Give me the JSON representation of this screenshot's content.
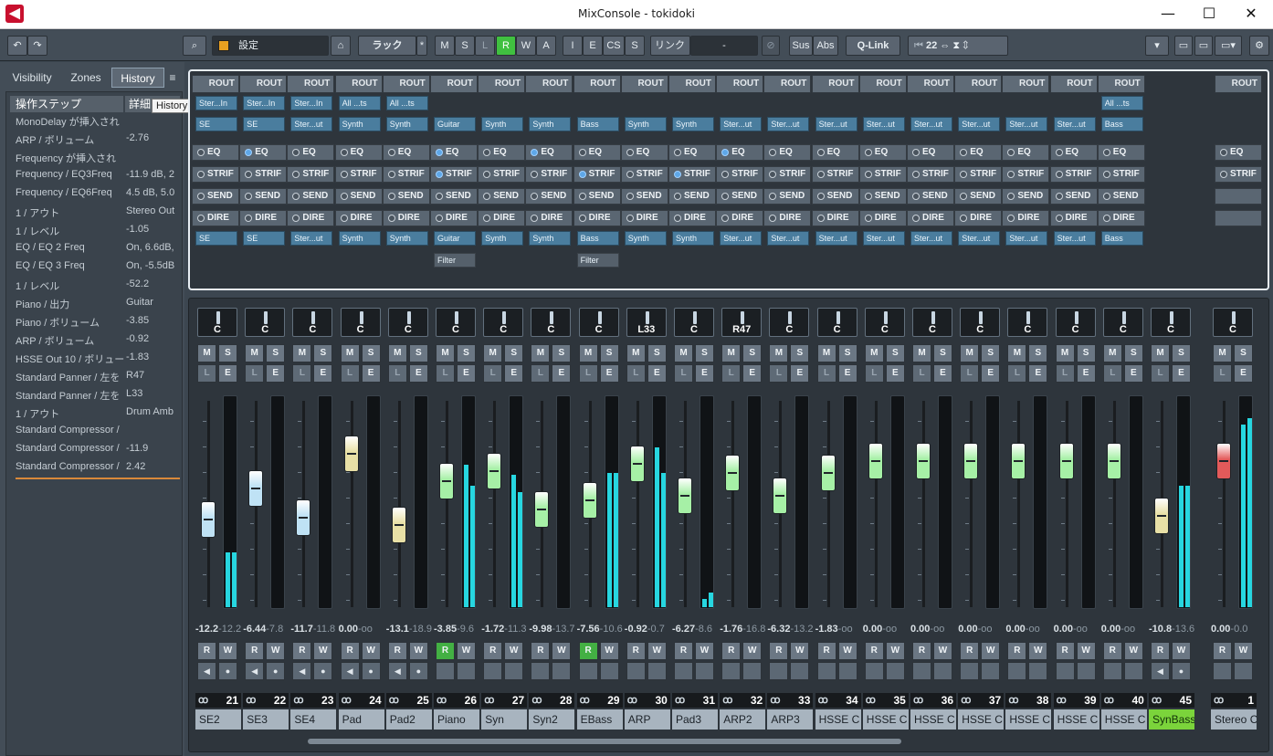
{
  "window": {
    "title": "MixConsole - tokidoki",
    "min": "—",
    "max": "☐",
    "close": "✕",
    "logo": "◀"
  },
  "toolbar": {
    "undo": "↶",
    "redo": "↷",
    "search": "⌕",
    "preset": "設定",
    "rack": "ラック",
    "rack_star": "*",
    "m": "M",
    "s": "S",
    "l": "L",
    "r": "R",
    "w": "W",
    "a": "A",
    "i": "I",
    "e": "E",
    "cs": "CS",
    "s2": "S",
    "link": "リンク",
    "link_value": "-",
    "sus": "Sus",
    "abs": "Abs",
    "qlink": "Q-Link",
    "count": "22",
    "menu_arrow": "▾",
    "gear": "⚙"
  },
  "left": {
    "tabs": [
      {
        "label": "Visibility"
      },
      {
        "label": "Zones"
      },
      {
        "label": "History"
      }
    ],
    "tooltip": "History",
    "headers": {
      "step": "操作ステップ",
      "detail": "詳細"
    },
    "rows": [
      {
        "a": "MonoDelay が挿入され",
        "b": ""
      },
      {
        "a": "ARP / ボリューム",
        "b": "-2.76"
      },
      {
        "a": "Frequency が挿入され",
        "b": ""
      },
      {
        "a": "Frequency / EQ3Freq",
        "b": "-11.9 dB, 2"
      },
      {
        "a": "Frequency / EQ6Freq",
        "b": "4.5 dB, 5.0"
      },
      {
        "a": "1 / アウト",
        "b": "Stereo Out"
      },
      {
        "a": "1 / レベル",
        "b": "-1.05"
      },
      {
        "a": "EQ / EQ 2 Freq",
        "b": "On, 6.6dB,"
      },
      {
        "a": "EQ / EQ 3 Freq",
        "b": "On, -5.5dB"
      },
      {
        "a": "1 / レベル",
        "b": "-52.2"
      },
      {
        "a": "Piano / 出力",
        "b": "Guitar"
      },
      {
        "a": "Piano / ボリューム",
        "b": "-3.85"
      },
      {
        "a": "ARP / ボリューム",
        "b": "-0.92"
      },
      {
        "a": "HSSE Out 10 / ボリュー",
        "b": "-1.83"
      },
      {
        "a": "Standard Panner / 左を",
        "b": "R47"
      },
      {
        "a": "Standard Panner / 左を",
        "b": "L33"
      },
      {
        "a": "1 / アウト",
        "b": "Drum Amb"
      },
      {
        "a": "Standard Compressor /",
        "b": ""
      },
      {
        "a": "Standard Compressor /",
        "b": "-11.9"
      },
      {
        "a": "Standard Compressor /",
        "b": "2.42"
      }
    ]
  },
  "routing": {
    "rout": "ROUT",
    "eq": "EQ",
    "strip": "STRIF",
    "send": "SEND",
    "direct": "DIRE",
    "inputs": [
      "Ster...In",
      "Ster...In",
      "Ster...In",
      "All ...ts",
      "All ...ts",
      "",
      "",
      "",
      "",
      "",
      "",
      "",
      "",
      "",
      "",
      "",
      "",
      "",
      "",
      "All ...ts",
      ""
    ],
    "outputs": [
      "SE",
      "SE",
      "Ster...ut",
      "Synth",
      "Synth",
      "Guitar",
      "Synth",
      "Synth",
      "Bass",
      "Synth",
      "Synth",
      "Ster...ut",
      "Ster...ut",
      "Ster...ut",
      "Ster...ut",
      "Ster...ut",
      "Ster...ut",
      "Ster...ut",
      "Ster...ut",
      "Bass",
      ""
    ],
    "filters": [
      "",
      "",
      "",
      "",
      "",
      "Filter",
      "",
      "",
      "Filter",
      "",
      "",
      "",
      "",
      "",
      "",
      "",
      "",
      "",
      "",
      "",
      ""
    ]
  },
  "channels": [
    {
      "name": "SE2",
      "num": "21",
      "pan": "C",
      "vol": "-12.2",
      "peak": "-12.2",
      "fader": 0.42,
      "color": "#bfe2f5",
      "meter": [
        0.26,
        0.26
      ],
      "rw": "rw",
      "bottom": "mono"
    },
    {
      "name": "SE3",
      "num": "22",
      "pan": "C",
      "vol": "-6.44",
      "peak": "-7.8",
      "fader": 0.6,
      "color": "#bfe2f5",
      "meter": [
        0,
        0
      ],
      "rw": "rw",
      "bottom": "mono"
    },
    {
      "name": "SE4",
      "num": "23",
      "pan": "C",
      "vol": "-11.7",
      "peak": "-11.8",
      "fader": 0.43,
      "color": "#bfe2f5",
      "meter": [
        0,
        0
      ],
      "rw": "rw",
      "bottom": "mono"
    },
    {
      "name": "Pad",
      "num": "24",
      "pan": "C",
      "vol": "0.00",
      "peak": "-oo",
      "fader": 0.8,
      "color": "#e8e0a6",
      "meter": [
        0,
        0
      ],
      "rw": "rw",
      "bottom": "mono"
    },
    {
      "name": "Pad2",
      "num": "25",
      "pan": "C",
      "vol": "-13.1",
      "peak": "-18.9",
      "fader": 0.39,
      "color": "#e8e0a6",
      "meter": [
        0,
        0
      ],
      "rw": "rw",
      "bottom": "mono"
    },
    {
      "name": "Piano",
      "num": "26",
      "pan": "C",
      "vol": "-3.85",
      "peak": "-9.6",
      "fader": 0.64,
      "color": "#a6f0a6",
      "meter": [
        0.68,
        0.58
      ],
      "rw": "Rw",
      "bottom": "none"
    },
    {
      "name": "Syn",
      "num": "27",
      "pan": "C",
      "vol": "-1.72",
      "peak": "-11.3",
      "fader": 0.7,
      "color": "#a6f0a6",
      "meter": [
        0.63,
        0.55
      ],
      "rw": "rw",
      "bottom": "none"
    },
    {
      "name": "Syn2",
      "num": "28",
      "pan": "C",
      "vol": "-9.98",
      "peak": "-13.7",
      "fader": 0.48,
      "color": "#a6f0a6",
      "meter": [
        0,
        0
      ],
      "rw": "rw",
      "bottom": "none"
    },
    {
      "name": "EBass",
      "num": "29",
      "pan": "C",
      "vol": "-7.56",
      "peak": "-10.6",
      "fader": 0.53,
      "color": "#a6f0a6",
      "meter": [
        0.64,
        0.64
      ],
      "rw": "Rw",
      "bottom": "none"
    },
    {
      "name": "ARP",
      "num": "30",
      "pan": "L33",
      "vol": "-0.92",
      "peak": "-0.7",
      "fader": 0.74,
      "color": "#a6f0a6",
      "meter": [
        0.76,
        0.64
      ],
      "rw": "rw",
      "bottom": "none"
    },
    {
      "name": "Pad3",
      "num": "31",
      "pan": "C",
      "vol": "-6.27",
      "peak": "-8.6",
      "fader": 0.56,
      "color": "#a6f0a6",
      "meter": [
        0.04,
        0.07
      ],
      "rw": "rw",
      "bottom": "none"
    },
    {
      "name": "ARP2",
      "num": "32",
      "pan": "R47",
      "vol": "-1.76",
      "peak": "-16.8",
      "fader": 0.69,
      "color": "#a6f0a6",
      "meter": [
        0,
        0
      ],
      "rw": "rw",
      "bottom": "none"
    },
    {
      "name": "ARP3",
      "num": "33",
      "pan": "C",
      "vol": "-6.32",
      "peak": "-13.2",
      "fader": 0.56,
      "color": "#a6f0a6",
      "meter": [
        0,
        0
      ],
      "rw": "rw",
      "bottom": "none"
    },
    {
      "name": "HSSE C",
      "num": "34",
      "pan": "C",
      "vol": "-1.83",
      "peak": "-oo",
      "fader": 0.69,
      "color": "#a6f0a6",
      "meter": [
        0,
        0
      ],
      "rw": "rw",
      "bottom": "none"
    },
    {
      "name": "HSSE C",
      "num": "35",
      "pan": "C",
      "vol": "0.00",
      "peak": "-oo",
      "fader": 0.76,
      "color": "#a6f0a6",
      "meter": [
        0,
        0
      ],
      "rw": "rw",
      "bottom": "none"
    },
    {
      "name": "HSSE C",
      "num": "36",
      "pan": "C",
      "vol": "0.00",
      "peak": "-oo",
      "fader": 0.76,
      "color": "#a6f0a6",
      "meter": [
        0,
        0
      ],
      "rw": "rw",
      "bottom": "none"
    },
    {
      "name": "HSSE C",
      "num": "37",
      "pan": "C",
      "vol": "0.00",
      "peak": "-oo",
      "fader": 0.76,
      "color": "#a6f0a6",
      "meter": [
        0,
        0
      ],
      "rw": "rw",
      "bottom": "none"
    },
    {
      "name": "HSSE C",
      "num": "38",
      "pan": "C",
      "vol": "0.00",
      "peak": "-oo",
      "fader": 0.76,
      "color": "#a6f0a6",
      "meter": [
        0,
        0
      ],
      "rw": "rw",
      "bottom": "none"
    },
    {
      "name": "HSSE C",
      "num": "39",
      "pan": "C",
      "vol": "0.00",
      "peak": "-oo",
      "fader": 0.76,
      "color": "#a6f0a6",
      "meter": [
        0,
        0
      ],
      "rw": "rw",
      "bottom": "none"
    },
    {
      "name": "HSSE C",
      "num": "40",
      "pan": "C",
      "vol": "0.00",
      "peak": "-oo",
      "fader": 0.76,
      "color": "#a6f0a6",
      "meter": [
        0,
        0
      ],
      "rw": "rw",
      "bottom": "none"
    },
    {
      "name": "SynBass",
      "num": "45",
      "pan": "C",
      "vol": "-10.8",
      "peak": "-13.6",
      "fader": 0.44,
      "color": "#e8e0a6",
      "meter": [
        0.58,
        0.58
      ],
      "rw": "rw",
      "bottom": "mono",
      "selected": true
    },
    {
      "name": "Stereo C",
      "num": "1",
      "pan": "C",
      "vol": "0.00",
      "peak": "-0.0",
      "fader": 0.76,
      "color": "#e35a5a",
      "meter": [
        0.87,
        0.9
      ],
      "rw": "rw",
      "bottom": "none"
    }
  ]
}
